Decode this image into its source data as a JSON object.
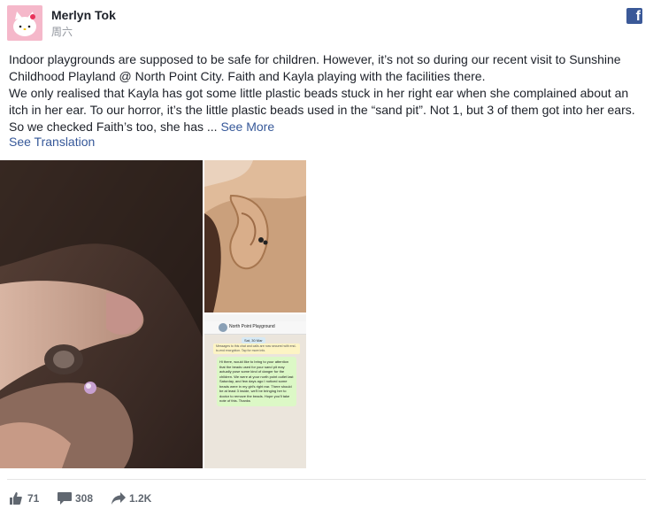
{
  "post": {
    "author": "Merlyn Tok",
    "date": "周六",
    "paragraph1": "Indoor playgrounds are supposed to be safe for children. However, it’s not so during our recent visit to Sunshine Childhood Playland @ North Point City. Faith and Kayla playing with the facilities there.",
    "paragraph2": "We only realised that Kayla has got some little plastic beads stuck in her right ear when she complained about an itch in her ear. To our horror, it’s the little plastic beads used in the “sand pit”. Not 1, but 3 of them got into her ears. So we checked Faith’s too, she has ...",
    "see_more": "See More",
    "see_translation": "See Translation"
  },
  "chat_screenshot": {
    "title": "North Point Playground",
    "date": "Sat, 30 Mar",
    "notice": "Messages to this chat and calls are now secured with end-to-end encryption. Tap for more info.",
    "message": "Hi there, would like to bring to your attention that the beads used for your sand pit may actually pose some kind of danger for the children. We were at your north point outlet last Saturday, and few days ago I noticed some beads were in my girl's right ear. There should be at least 3 inside, we'll be bringing her to doctor to remove the beads. Hope you'll take note of this. Thanks"
  },
  "actions": {
    "likes": "71",
    "comments": "308",
    "shares": "1.2K"
  },
  "icons": {
    "brand": "facebook-icon",
    "like": "thumbs-up-icon",
    "comment": "comment-icon",
    "share": "share-arrow-icon"
  },
  "colors": {
    "link": "#365899",
    "facebook_blue": "#3b5998",
    "meta_text": "#90949c"
  }
}
